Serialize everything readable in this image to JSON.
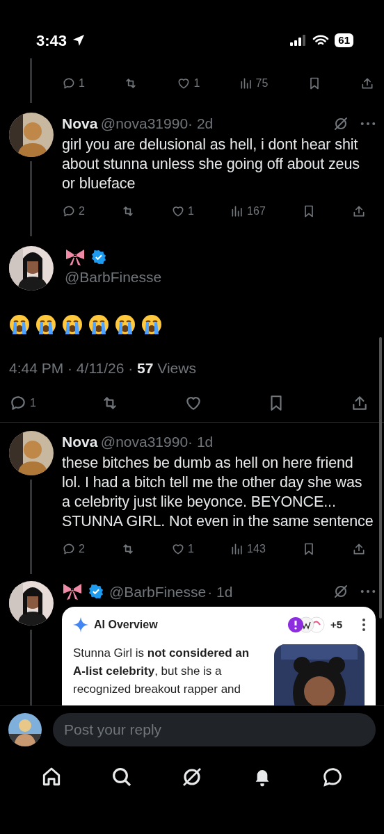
{
  "status_bar": {
    "time": "3:43",
    "battery": "61"
  },
  "tweets": [
    {
      "kind": "fragment",
      "stats": {
        "replies": "1",
        "likes": "1",
        "views": "75"
      }
    },
    {
      "kind": "reply",
      "name": "Nova",
      "handle": "@nova31990",
      "age": "· 2d",
      "grok": true,
      "text": "girl you are delusional as hell, i dont hear shit about stunna unless she going off about zeus or blueface",
      "stats": {
        "replies": "2",
        "likes": "1",
        "views": "167"
      }
    },
    {
      "kind": "main",
      "handle": "@BarbFinesse",
      "verified": true,
      "emojis": [
        {
          "kind": "loudly-crying"
        },
        {
          "kind": "loudly-crying"
        },
        {
          "kind": "loudly-crying"
        },
        {
          "kind": "loudly-crying"
        },
        {
          "kind": "loudly-crying"
        },
        {
          "kind": "loudly-crying"
        }
      ],
      "meta": "4:44 PM · 4/11/26 · ",
      "views_count": "57",
      "views_label": "Views",
      "stats": {
        "replies": "1"
      }
    },
    {
      "kind": "reply",
      "name": "Nova",
      "handle": "@nova31990",
      "age": "· 1d",
      "grok": false,
      "text": "these bitches be dumb as hell on here friend lol. I had a bitch tell me the other day she was a celebrity just like beyonce. BEYONCE... STUNNA GIRL. Not even in the same sentence",
      "stats": {
        "replies": "2",
        "likes": "1",
        "views": "143"
      }
    },
    {
      "kind": "card_reply",
      "handle": "@BarbFinesse",
      "age": "· 1d",
      "verified": true,
      "grok": true,
      "card": {
        "title": "AI Overview",
        "sources_more": "+5",
        "text": "Stunna Girl is **not considered an A-list celebrity**, but she is a recognized breakout rapper and"
      }
    }
  ],
  "reply_bar": {
    "placeholder": "Post your reply"
  }
}
